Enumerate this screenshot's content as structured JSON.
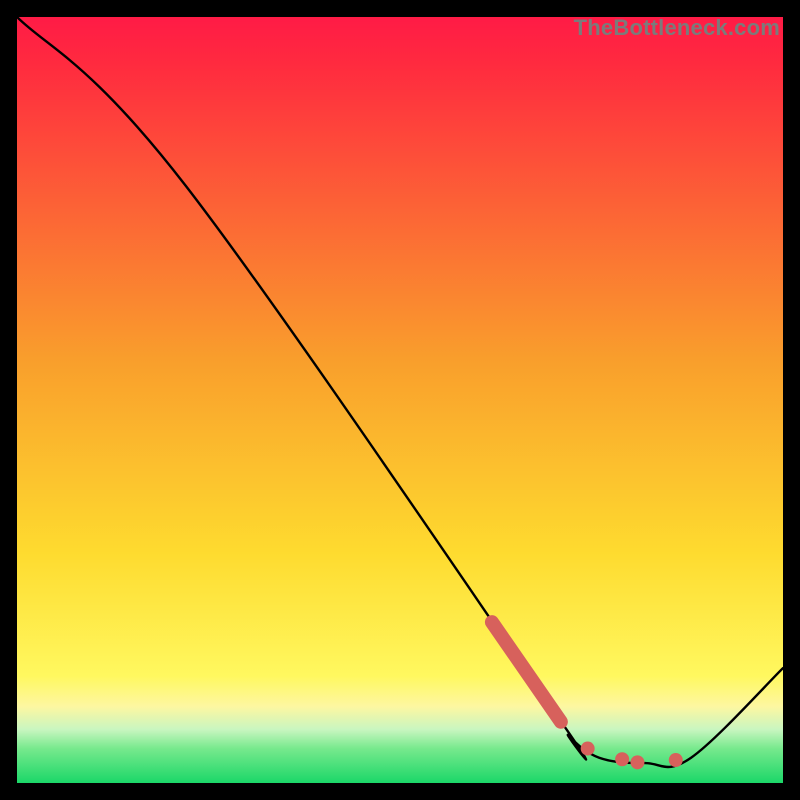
{
  "watermark": "TheBottleneck.com",
  "colors": {
    "bg": "#000000",
    "line": "#000000",
    "marker": "#d7615c",
    "grad_top": "#ff1b46",
    "grad_yellow_top": "#fedb2f",
    "grad_yellow_bot_band": "#fdf7a1",
    "grad_palegreen": "#c9f6c0",
    "grad_green": "#1bd768"
  },
  "chart_data": {
    "type": "line",
    "title": "",
    "xlabel": "",
    "ylabel": "",
    "xlim": [
      0,
      100
    ],
    "ylim": [
      0,
      100
    ],
    "series": [
      {
        "name": "curve",
        "points": [
          {
            "x": 0,
            "y": 100
          },
          {
            "x": 22,
            "y": 78
          },
          {
            "x": 70,
            "y": 9.5
          },
          {
            "x": 72,
            "y": 6.2
          },
          {
            "x": 76,
            "y": 3.3
          },
          {
            "x": 82,
            "y": 2.6
          },
          {
            "x": 88,
            "y": 3.3
          },
          {
            "x": 100,
            "y": 15
          }
        ]
      }
    ],
    "highlight_segment": {
      "x1": 62,
      "y1": 21,
      "x2": 71,
      "y2": 8
    },
    "markers": [
      {
        "x": 74.5,
        "y": 4.5
      },
      {
        "x": 79,
        "y": 3.1
      },
      {
        "x": 81,
        "y": 2.7
      },
      {
        "x": 86,
        "y": 3.0
      }
    ]
  }
}
